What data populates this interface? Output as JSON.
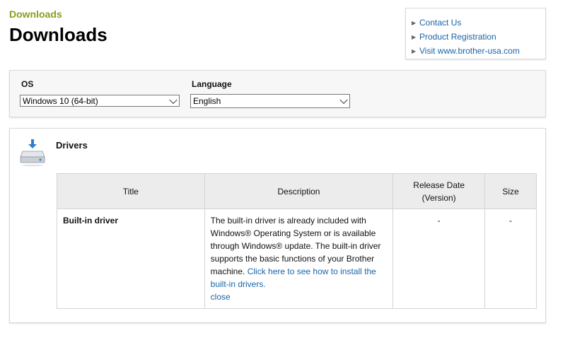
{
  "header": {
    "breadcrumb": "Downloads",
    "title": "Downloads"
  },
  "links": [
    {
      "label": "Contact Us"
    },
    {
      "label": "Product Registration"
    },
    {
      "label": "Visit www.brother-usa.com"
    }
  ],
  "filters": {
    "os_label": "OS",
    "os_value": "Windows 10 (64-bit)",
    "language_label": "Language",
    "language_value": "English"
  },
  "drivers": {
    "section_title": "Drivers",
    "columns": {
      "title": "Title",
      "description": "Description",
      "release_date_line1": "Release Date",
      "release_date_line2": "(Version)",
      "size": "Size"
    },
    "rows": [
      {
        "title": "Built-in driver",
        "description": "The built-in driver is already included with Windows® Operating System or is available through Windows® update. The built-in driver supports the basic functions of your Brother machine.",
        "install_link": "Click here to see how to install the built-in drivers.",
        "close_link": "close",
        "release_date": "-",
        "size": "-"
      }
    ]
  },
  "colors": {
    "breadcrumb": "#84a01b",
    "link": "#1a64a8",
    "table_header_bg": "#ececec",
    "panel_bg": "#f7f7f7"
  },
  "icons": {
    "drivers": "download-drive-icon",
    "link_bullet": "chevron-right-icon",
    "dropdown": "chevron-down-icon"
  }
}
